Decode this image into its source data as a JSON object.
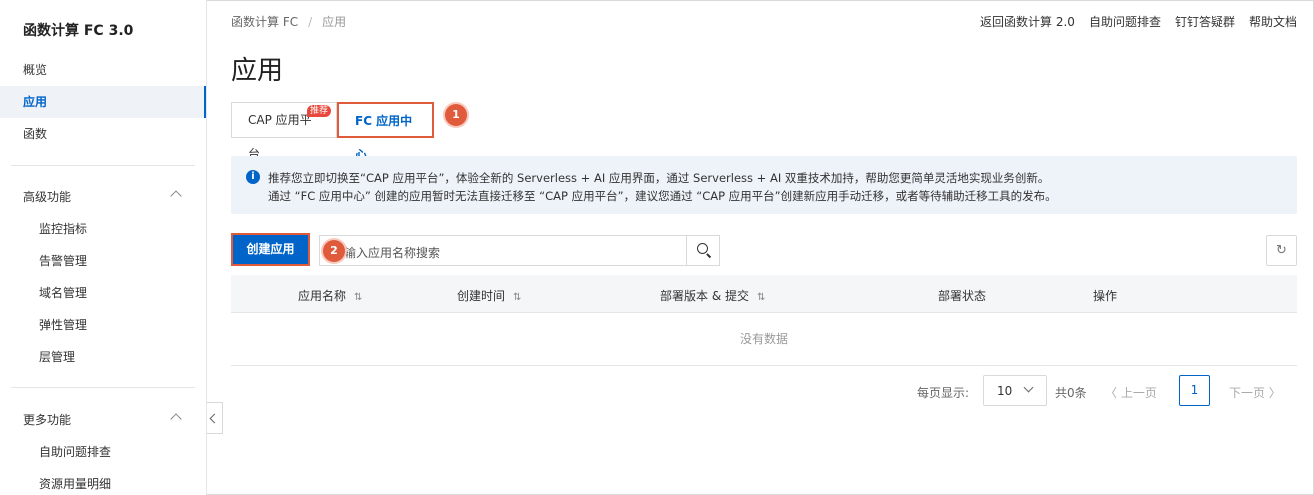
{
  "sidebar": {
    "title": "函数计算 FC 3.0",
    "items": [
      {
        "label": "概览"
      },
      {
        "label": "应用"
      },
      {
        "label": "函数"
      }
    ],
    "advanced": {
      "label": "高级功能",
      "items": [
        {
          "label": "监控指标"
        },
        {
          "label": "告警管理"
        },
        {
          "label": "域名管理"
        },
        {
          "label": "弹性管理"
        },
        {
          "label": "层管理"
        }
      ]
    },
    "more": {
      "label": "更多功能",
      "items": [
        {
          "label": "自助问题排查"
        },
        {
          "label": "资源用量明细"
        }
      ]
    }
  },
  "header": {
    "breadcrumb": [
      "函数计算 FC",
      "应用"
    ],
    "links": [
      "返回函数计算 2.0",
      "自助问题排查",
      "钉钉答疑群",
      "帮助文档"
    ],
    "title": "应用"
  },
  "tabs": [
    {
      "label": "CAP 应用平台",
      "badge": "推荐"
    },
    {
      "label": "FC 应用中心",
      "selected": true
    }
  ],
  "steps": [
    "1",
    "2"
  ],
  "notice": {
    "line1": "推荐您立即切换至“CAP 应用平台”，体验全新的 Serverless + AI 应用界面，通过 Serverless + AI 双重技术加持，帮助您更简单灵活地实现业务创新。",
    "line2": "通过 “FC 应用中心” 创建的应用暂时无法直接迁移至 “CAP 应用平台”，建议您通过 “CAP 应用平台”创建新应用手动迁移，或者等待辅助迁移工具的发布。"
  },
  "toolbar": {
    "create_label": "创建应用",
    "search_placeholder": "输入应用名称搜索"
  },
  "table": {
    "columns": [
      "应用名称",
      "创建时间",
      "部署版本 & 提交",
      "部署状态",
      "操作"
    ],
    "empty_text": "没有数据"
  },
  "pagination": {
    "per_page_label": "每页显示:",
    "per_page_value": "10",
    "total_label": "共0条",
    "prev_label": "上一页",
    "current_page": "1",
    "next_label": "下一页"
  },
  "colors": {
    "primary": "#0064c8",
    "highlight": "#e05a3c",
    "badge": "#e8483b"
  }
}
